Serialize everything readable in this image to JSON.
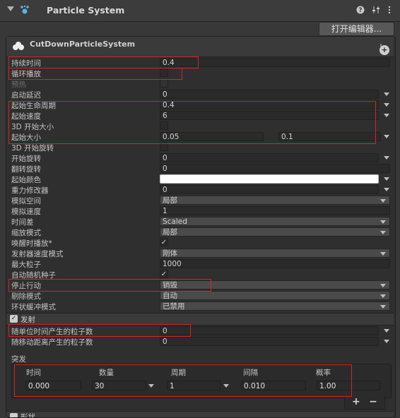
{
  "header": {
    "title": "Particle System",
    "help_icon": "help-icon",
    "preset_icon": "preset-icon",
    "menu_icon": "menu-icon"
  },
  "open_editor_label": "打开编辑器...",
  "system": {
    "name": "CutDownParticleSystem",
    "add_module_icon": "plus-icon"
  },
  "properties": {
    "duration": {
      "label": "持续时间",
      "value": "0.4"
    },
    "looping": {
      "label": "循环播放",
      "checked": false
    },
    "prewarm": {
      "label": "预热",
      "checked": false
    },
    "start_delay": {
      "label": "启动延迟",
      "value": "0"
    },
    "start_lifetime": {
      "label": "起始生命周期",
      "value": "0.4"
    },
    "start_speed": {
      "label": "起始速度",
      "value": "6"
    },
    "start_size_3d": {
      "label": "3D 开始大小",
      "checked": false
    },
    "start_size": {
      "label": "起始大小",
      "min": "0.05",
      "max": "0.1"
    },
    "start_rotation_3d": {
      "label": "3D 开始旋转",
      "checked": false
    },
    "start_rotation": {
      "label": "开始旋转",
      "value": "0"
    },
    "flip_rotation": {
      "label": "翻转旋转",
      "value": "0"
    },
    "start_color": {
      "label": "起始颜色",
      "color": "#ffffff"
    },
    "gravity_modifier": {
      "label": "重力修改器",
      "value": "0"
    },
    "simulation_space": {
      "label": "模拟空间",
      "value": "局部"
    },
    "simulation_speed": {
      "label": "模拟速度",
      "value": "1"
    },
    "delta_time": {
      "label": "时间差",
      "value": "Scaled"
    },
    "scaling_mode": {
      "label": "缩放模式",
      "value": "局部"
    },
    "play_on_awake": {
      "label": "唤醒时播放*",
      "checked": true
    },
    "emitter_velocity_mode": {
      "label": "发射器速度模式",
      "value": "刚体"
    },
    "max_particles": {
      "label": "最大粒子",
      "value": "1000"
    },
    "auto_random_seed": {
      "label": "自动随机种子",
      "checked": true
    },
    "stop_action": {
      "label": "停止行动",
      "value": "销毁"
    },
    "culling_mode": {
      "label": "剔除模式",
      "value": "自动"
    },
    "ring_buffer_mode": {
      "label": "环状缓冲模式",
      "value": "已禁用"
    }
  },
  "emission": {
    "module_label": "发射",
    "enabled": true,
    "rate_over_time": {
      "label": "随单位时间产生的粒子数",
      "value": "0"
    },
    "rate_over_distance": {
      "label": "随移动距离产生的粒子数",
      "value": "0"
    },
    "bursts_label": "突发",
    "bursts_headers": [
      "时间",
      "数量",
      "周期",
      "间隔",
      "概率"
    ],
    "bursts": [
      {
        "time": "0.000",
        "count": "30",
        "cycles": "1",
        "interval": "0.010",
        "probability": "1.00"
      }
    ],
    "add_label": "+",
    "remove_label": "−"
  },
  "next_module_label": "形状",
  "colors": {
    "highlight": "#d0262a",
    "background": "#383838"
  }
}
